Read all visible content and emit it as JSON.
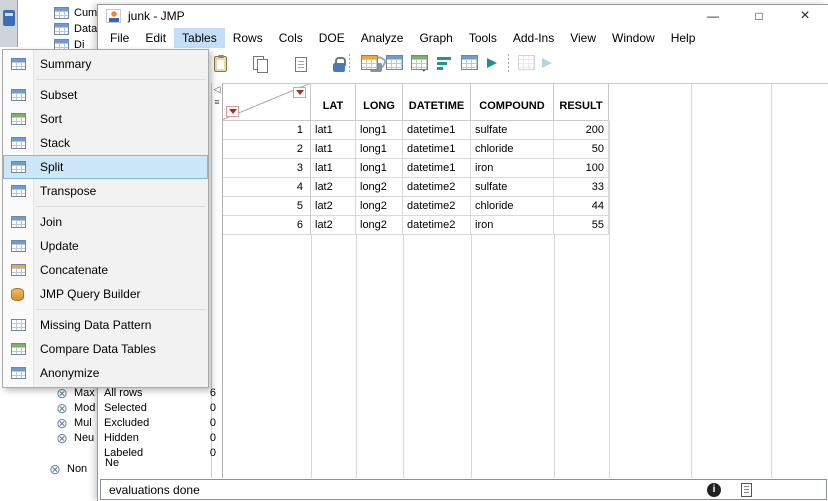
{
  "window": {
    "title": "junk - JMP",
    "controls": {
      "minimize": "—",
      "maximize": "□",
      "close": "×"
    }
  },
  "menubar": {
    "items": [
      "File",
      "Edit",
      "Tables",
      "Rows",
      "Cols",
      "DOE",
      "Analyze",
      "Graph",
      "Tools",
      "Add-Ins",
      "View",
      "Window",
      "Help"
    ],
    "active_item": "Tables"
  },
  "toolbar": {
    "icons": [
      "paste",
      "copy",
      "journal",
      "lock",
      "unlock",
      "search",
      "new-data-table",
      "data-table",
      "subset-table",
      "sort-columns",
      "summary-stats",
      "run-script",
      "disabled-table",
      "disabled-script"
    ]
  },
  "tables_menu": {
    "items": [
      {
        "label": "Summary"
      },
      {
        "label": "Subset"
      },
      {
        "label": "Sort"
      },
      {
        "label": "Stack"
      },
      {
        "label": "Split",
        "highlighted": true
      },
      {
        "label": "Transpose"
      },
      {
        "label": "Join"
      },
      {
        "label": "Update"
      },
      {
        "label": "Concatenate"
      },
      {
        "label": "JMP Query Builder"
      },
      {
        "label": "Missing Data Pattern"
      },
      {
        "label": "Compare Data Tables"
      },
      {
        "label": "Anonymize"
      }
    ]
  },
  "data_table": {
    "columns": [
      "LAT",
      "LONG",
      "DATETIME",
      "COMPOUND",
      "RESULT"
    ],
    "rows": [
      [
        "1",
        "lat1",
        "long1",
        "datetime1",
        "sulfate",
        "200"
      ],
      [
        "2",
        "lat1",
        "long1",
        "datetime1",
        "chloride",
        "50"
      ],
      [
        "3",
        "lat1",
        "long1",
        "datetime1",
        "iron",
        "100"
      ],
      [
        "4",
        "lat2",
        "long2",
        "datetime2",
        "sulfate",
        "33"
      ],
      [
        "5",
        "lat2",
        "long2",
        "datetime2",
        "chloride",
        "44"
      ],
      [
        "6",
        "lat2",
        "long2",
        "datetime2",
        "iron",
        "55"
      ]
    ]
  },
  "rows_panel": {
    "items": [
      {
        "label": "All rows",
        "value": "6"
      },
      {
        "label": "Selected",
        "value": "0"
      },
      {
        "label": "Excluded",
        "value": "0"
      },
      {
        "label": "Hidden",
        "value": "0"
      },
      {
        "label": "Labeled",
        "value": "0"
      }
    ]
  },
  "statusbar": {
    "text": "evaluations done"
  },
  "background_window": {
    "top_items": [
      "Cum",
      "Data",
      "Di"
    ],
    "bottom_items": [
      "Max",
      "Mod",
      "Mul",
      "Neu",
      "Non"
    ],
    "partial_text": "Ne"
  },
  "colors": {
    "menu_highlight": "#cde6f8",
    "menu_highlight_border": "#84b6e0",
    "active_menu": "#c3def5",
    "red_triangle": "#b02a2a",
    "teal_icon": "#21958f"
  }
}
